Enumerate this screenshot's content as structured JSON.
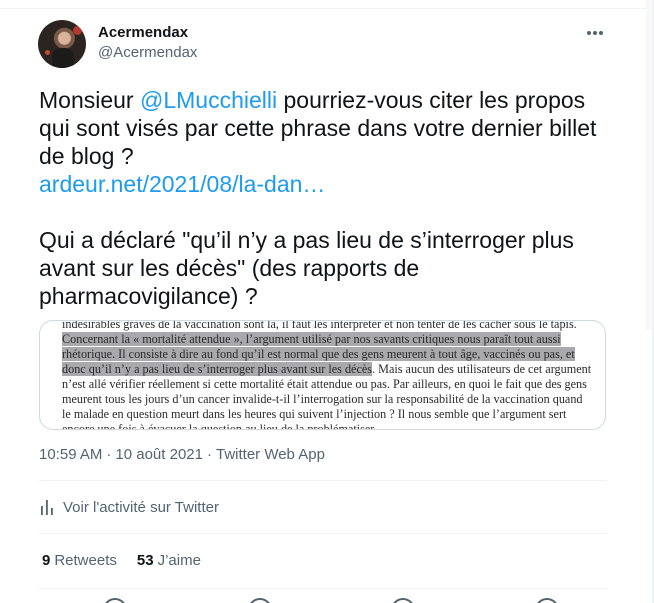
{
  "author": {
    "display_name": "Acermendax",
    "handle": "@Acermendax"
  },
  "tweet": {
    "line1_pre": "Monsieur ",
    "mention": "@LMucchielli",
    "line1_post": " pourriez-vous citer les propos",
    "line2": "qui sont visés par cette phrase dans votre dernier billet",
    "line3": "de blog ?",
    "link": "ardeur.net/2021/08/la-dan…",
    "line5": "Qui a déclaré \"qu’il n’y a pas lieu de s’interroger plus",
    "line6": "avant sur les décès\" (des rapports de",
    "line7": "pharmacovigilance) ?"
  },
  "image_text": {
    "l1": "indésirables graves de la vaccination sont là, il faut les interpréter et non tenter de les cacher sous le tapis.",
    "l2": "Concernant la « mortalité attendue », l’argument utilisé par nos savants critiques nous paraît tout aussi",
    "l3": "rhétorique. Il consiste à dire au fond qu’il est normal que des gens meurent à tout âge, vaccinés ou pas, et",
    "l4_hl": "donc qu’il n’y a pas lieu de s’interroger plus avant sur les décès",
    "l4_rest": ". Mais aucun des utilisateurs de cet argument",
    "l5": "n’est allé vérifier réellement si cette mortalité était attendue ou pas. Par ailleurs, en quoi le fait que des gens",
    "l6": "meurent tous les jours d’un cancer invalide-t-il l’interrogation sur la responsabilité de la vaccination quand",
    "l7": "le malade en question meurt dans les heures qui suivent l’injection ? Il nous semble que l’argument sert",
    "l8": "encore une fois à évacuer la question au lieu de la problématiser."
  },
  "meta": {
    "time": "10:59 AM",
    "dot1": "·",
    "date": "10 août 2021",
    "dot2": "·",
    "source": "Twitter Web App"
  },
  "activity_label": "Voir l'activité sur Twitter",
  "stats": {
    "retweets_count": "9",
    "retweets_label": "Retweets",
    "likes_count": "53",
    "likes_label": "J’aime"
  },
  "colors": {
    "accent": "#1d9bf0",
    "text": "#0f1419",
    "secondary": "#536471",
    "border": "#eff3f4"
  }
}
